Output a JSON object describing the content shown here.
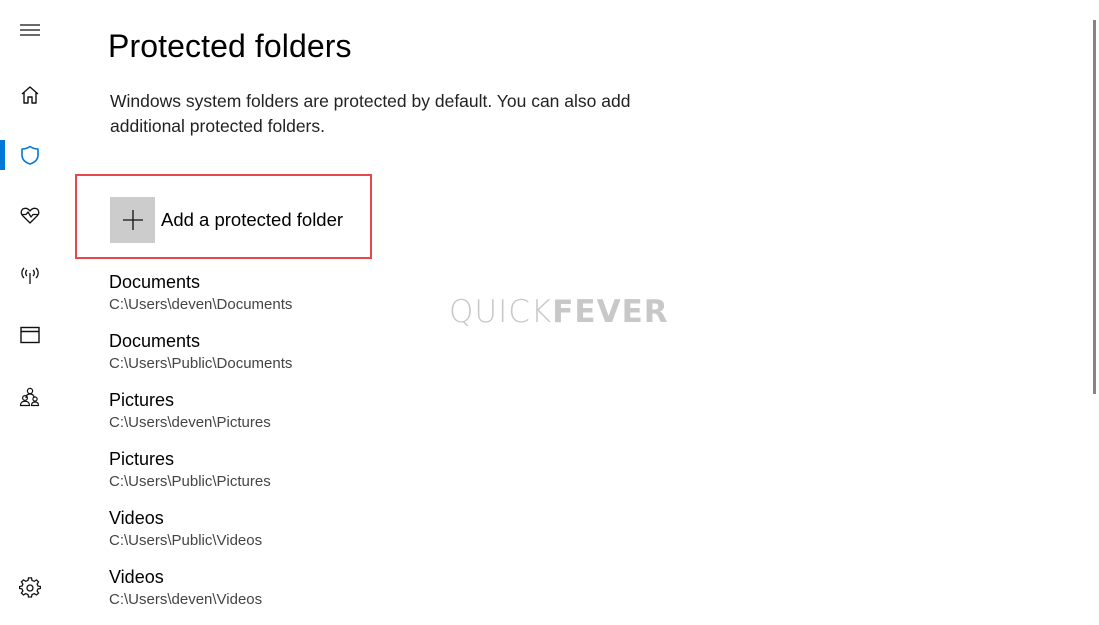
{
  "nav": {
    "items": [
      {
        "id": "menu",
        "icon": "hamburger-menu-icon"
      },
      {
        "id": "home",
        "icon": "home-icon"
      },
      {
        "id": "virus-threat-protection",
        "icon": "shield-icon",
        "selected": true
      },
      {
        "id": "device-performance-health",
        "icon": "heart-pulse-icon"
      },
      {
        "id": "firewall-network",
        "icon": "antenna-signal-icon"
      },
      {
        "id": "app-browser-control",
        "icon": "browser-window-icon"
      },
      {
        "id": "family-options",
        "icon": "family-people-icon"
      },
      {
        "id": "settings",
        "icon": "gear-icon"
      }
    ],
    "accent_color": "#0078d7"
  },
  "page": {
    "title": "Protected folders",
    "description": "Windows system folders are protected by default. You can also add additional protected folders.",
    "add_button_label": "Add a protected folder",
    "highlight_color": "#e8474e"
  },
  "folders": [
    {
      "name": "Documents",
      "path": "C:\\Users\\deven\\Documents"
    },
    {
      "name": "Documents",
      "path": "C:\\Users\\Public\\Documents"
    },
    {
      "name": "Pictures",
      "path": "C:\\Users\\deven\\Pictures"
    },
    {
      "name": "Pictures",
      "path": "C:\\Users\\Public\\Pictures"
    },
    {
      "name": "Videos",
      "path": "C:\\Users\\Public\\Videos"
    },
    {
      "name": "Videos",
      "path": "C:\\Users\\deven\\Videos"
    }
  ],
  "watermark": {
    "part1": "QUICK",
    "part2": "FEVER"
  }
}
